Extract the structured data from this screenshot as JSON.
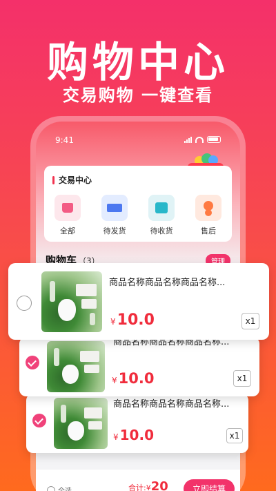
{
  "hero": {
    "title": "购物中心",
    "subtitle": "交易购物 一键查看"
  },
  "status_bar": {
    "time": "9:41"
  },
  "trade_center": {
    "title": "交易中心",
    "orders": [
      {
        "label": "全部",
        "icon": "basket-icon"
      },
      {
        "label": "待发货",
        "icon": "truck-icon"
      },
      {
        "label": "待收货",
        "icon": "inbox-check-icon"
      },
      {
        "label": "售后",
        "icon": "service-agent-icon"
      }
    ]
  },
  "cart": {
    "title": "购物车",
    "count": "（3）",
    "manage_label": "管理",
    "items": [
      {
        "name": "商品名称商品名称商品名称...",
        "currency": "¥",
        "price": "10.0",
        "qty": "x1",
        "checked": false
      },
      {
        "name": "商品名称商品名称商品名称...",
        "currency": "¥",
        "price": "10.0",
        "qty": "x1",
        "checked": true
      },
      {
        "name": "商品名称商品名称商品名称...",
        "currency": "¥",
        "price": "10.0",
        "qty": "x1",
        "checked": true
      }
    ]
  },
  "bottom_bar": {
    "select_all": "全选",
    "total_label": "合计:",
    "currency": "¥",
    "total_value": "20",
    "checkout_label": "立即结算"
  },
  "colors": {
    "accent": "#f2336a",
    "price": "#f02c3c"
  }
}
